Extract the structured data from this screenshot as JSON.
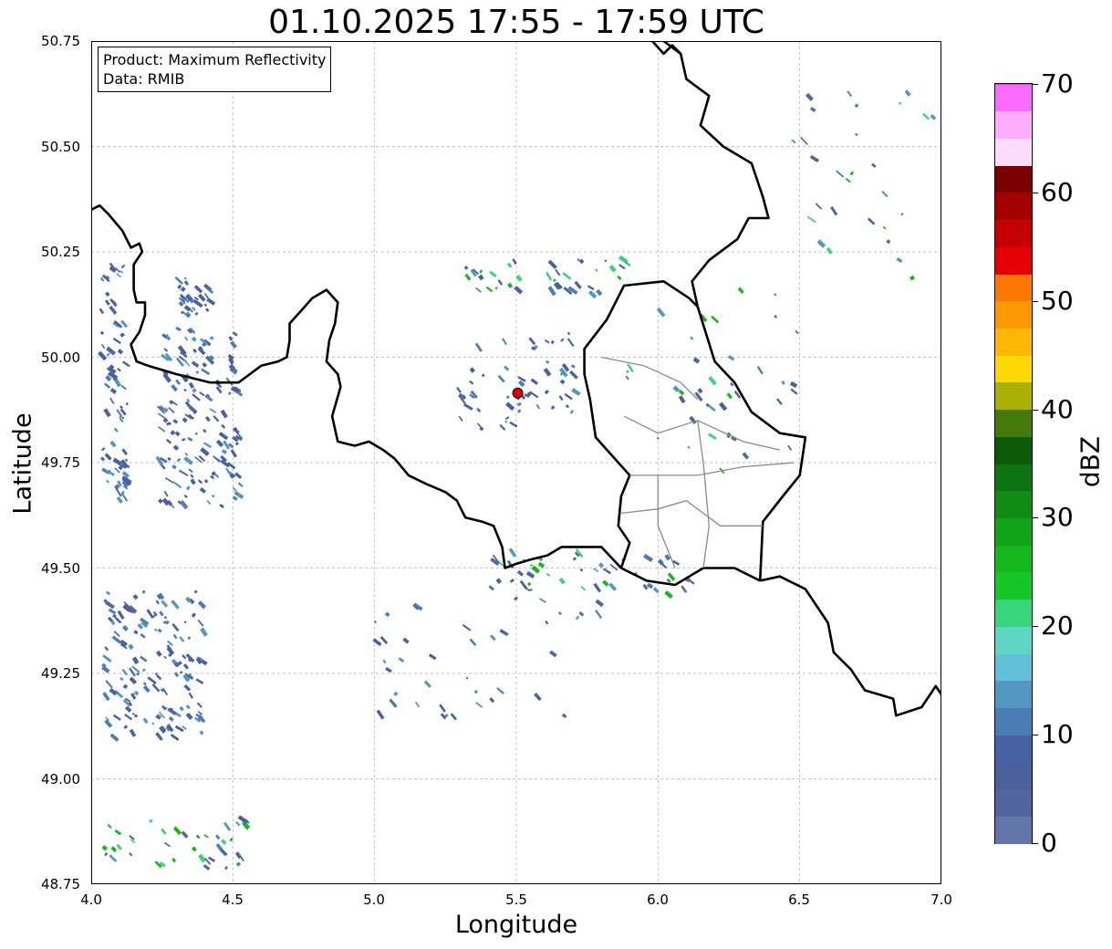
{
  "title": "01.10.2025 17:55 - 17:59 UTC",
  "xlabel": "Longitude",
  "ylabel": "Latitude",
  "x_ticks": [
    "4.0",
    "4.5",
    "5.0",
    "5.5",
    "6.0",
    "6.5",
    "7.0"
  ],
  "y_ticks": [
    "50.75",
    "50.50",
    "50.25",
    "50.00",
    "49.75",
    "49.50",
    "49.25",
    "49.00",
    "48.75"
  ],
  "infobox": {
    "product": "Product: Maximum Reflectivity",
    "data": "Data: RMIB"
  },
  "colorbar": {
    "unit": "dBZ",
    "min": 0,
    "max": 70,
    "step": 2.5,
    "labels": [
      "0",
      "10",
      "20",
      "30",
      "40",
      "50",
      "60",
      "70"
    ],
    "colors": [
      "#6374a8",
      "#52649f",
      "#4a5f9b",
      "#4661a4",
      "#4a7db4",
      "#5297c0",
      "#62c0d8",
      "#5fd6c4",
      "#38d67a",
      "#14c628",
      "#14b81c",
      "#12a418",
      "#108c14",
      "#0c7410",
      "#0a5a0a",
      "#467a08",
      "#aab006",
      "#fcd804",
      "#fcb604",
      "#fc9804",
      "#fc7804",
      "#e40004",
      "#c40002",
      "#a40000",
      "#7a0000",
      "#fcdcfc",
      "#fcaefc",
      "#fc6cfc",
      "#ec38ec"
    ]
  },
  "map": {
    "extent": {
      "lon": [
        4.0,
        7.0
      ],
      "lat": [
        48.75,
        50.75
      ]
    },
    "grid": true,
    "radar_site": {
      "lon": 5.505,
      "lat": 49.915
    },
    "borders": {
      "belgium_france": [
        [
          4.0,
          50.35
        ],
        [
          4.03,
          50.36
        ],
        [
          4.06,
          50.34
        ],
        [
          4.11,
          50.3
        ],
        [
          4.14,
          50.26
        ],
        [
          4.17,
          50.27
        ],
        [
          4.18,
          50.25
        ],
        [
          4.15,
          50.22
        ],
        [
          4.15,
          50.16
        ],
        [
          4.16,
          50.13
        ],
        [
          4.19,
          50.13
        ],
        [
          4.19,
          50.1
        ],
        [
          4.17,
          50.06
        ],
        [
          4.14,
          50.03
        ],
        [
          4.16,
          49.99
        ],
        [
          4.2,
          49.98
        ],
        [
          4.25,
          49.97
        ],
        [
          4.3,
          49.96
        ],
        [
          4.36,
          49.95
        ],
        [
          4.42,
          49.94
        ],
        [
          4.46,
          49.94
        ],
        [
          4.52,
          49.94
        ],
        [
          4.56,
          49.96
        ],
        [
          4.6,
          49.98
        ],
        [
          4.66,
          49.99
        ],
        [
          4.69,
          50.0
        ],
        [
          4.7,
          50.04
        ],
        [
          4.7,
          50.08
        ],
        [
          4.74,
          50.11
        ],
        [
          4.78,
          50.14
        ],
        [
          4.83,
          50.16
        ],
        [
          4.87,
          50.13
        ],
        [
          4.86,
          50.08
        ],
        [
          4.84,
          50.04
        ],
        [
          4.83,
          49.99
        ],
        [
          4.87,
          49.96
        ],
        [
          4.88,
          49.93
        ],
        [
          4.85,
          49.86
        ],
        [
          4.87,
          49.8
        ],
        [
          4.93,
          49.79
        ],
        [
          4.98,
          49.8
        ],
        [
          5.03,
          49.78
        ],
        [
          5.07,
          49.76
        ],
        [
          5.12,
          49.72
        ],
        [
          5.18,
          49.7
        ],
        [
          5.25,
          49.68
        ],
        [
          5.29,
          49.66
        ],
        [
          5.32,
          49.62
        ],
        [
          5.38,
          49.61
        ],
        [
          5.42,
          49.6
        ],
        [
          5.45,
          49.55
        ],
        [
          5.46,
          49.5
        ],
        [
          5.5,
          49.51
        ],
        [
          5.55,
          49.52
        ],
        [
          5.61,
          49.53
        ],
        [
          5.66,
          49.55
        ],
        [
          5.73,
          49.55
        ],
        [
          5.8,
          49.55
        ],
        [
          5.87,
          49.5
        ]
      ],
      "belgium_luxembourg": [
        [
          5.87,
          49.5
        ],
        [
          5.9,
          49.56
        ],
        [
          5.86,
          49.6
        ],
        [
          5.87,
          49.67
        ],
        [
          5.9,
          49.72
        ],
        [
          5.78,
          49.81
        ],
        [
          5.76,
          49.9
        ],
        [
          5.74,
          49.96
        ],
        [
          5.74,
          50.02
        ],
        [
          5.82,
          50.09
        ],
        [
          5.88,
          50.17
        ],
        [
          6.02,
          50.18
        ],
        [
          6.11,
          50.14
        ],
        [
          6.14,
          50.12
        ]
      ],
      "belgium_germany": [
        [
          6.14,
          50.12
        ],
        [
          6.12,
          50.18
        ],
        [
          6.18,
          50.23
        ],
        [
          6.28,
          50.28
        ],
        [
          6.32,
          50.33
        ],
        [
          6.39,
          50.33
        ],
        [
          6.37,
          50.38
        ],
        [
          6.33,
          50.46
        ],
        [
          6.23,
          50.5
        ],
        [
          6.15,
          50.55
        ],
        [
          6.18,
          50.62
        ],
        [
          6.1,
          50.66
        ],
        [
          6.08,
          50.72
        ],
        [
          6.02,
          50.75
        ]
      ],
      "luxembourg_germany": [
        [
          6.14,
          50.12
        ],
        [
          6.2,
          49.99
        ],
        [
          6.27,
          49.94
        ],
        [
          6.33,
          49.87
        ],
        [
          6.43,
          49.82
        ],
        [
          6.52,
          49.81
        ],
        [
          6.5,
          49.72
        ],
        [
          6.44,
          49.67
        ],
        [
          6.37,
          49.61
        ],
        [
          6.36,
          49.47
        ]
      ],
      "luxembourg_france": [
        [
          5.87,
          49.5
        ],
        [
          5.96,
          49.47
        ],
        [
          6.06,
          49.46
        ],
        [
          6.16,
          49.5
        ],
        [
          6.27,
          49.5
        ],
        [
          6.36,
          49.47
        ]
      ],
      "france_germany": [
        [
          6.36,
          49.47
        ],
        [
          6.43,
          49.48
        ],
        [
          6.52,
          49.45
        ],
        [
          6.55,
          49.42
        ],
        [
          6.6,
          49.37
        ],
        [
          6.62,
          49.3
        ],
        [
          6.68,
          49.26
        ],
        [
          6.73,
          49.21
        ],
        [
          6.83,
          49.19
        ],
        [
          6.84,
          49.15
        ],
        [
          6.93,
          49.17
        ],
        [
          6.98,
          49.22
        ],
        [
          7.0,
          49.2
        ]
      ],
      "germany_netherlands": [
        [
          5.98,
          50.75
        ],
        [
          6.02,
          50.72
        ],
        [
          6.05,
          50.74
        ],
        [
          6.08,
          50.72
        ]
      ]
    }
  }
}
